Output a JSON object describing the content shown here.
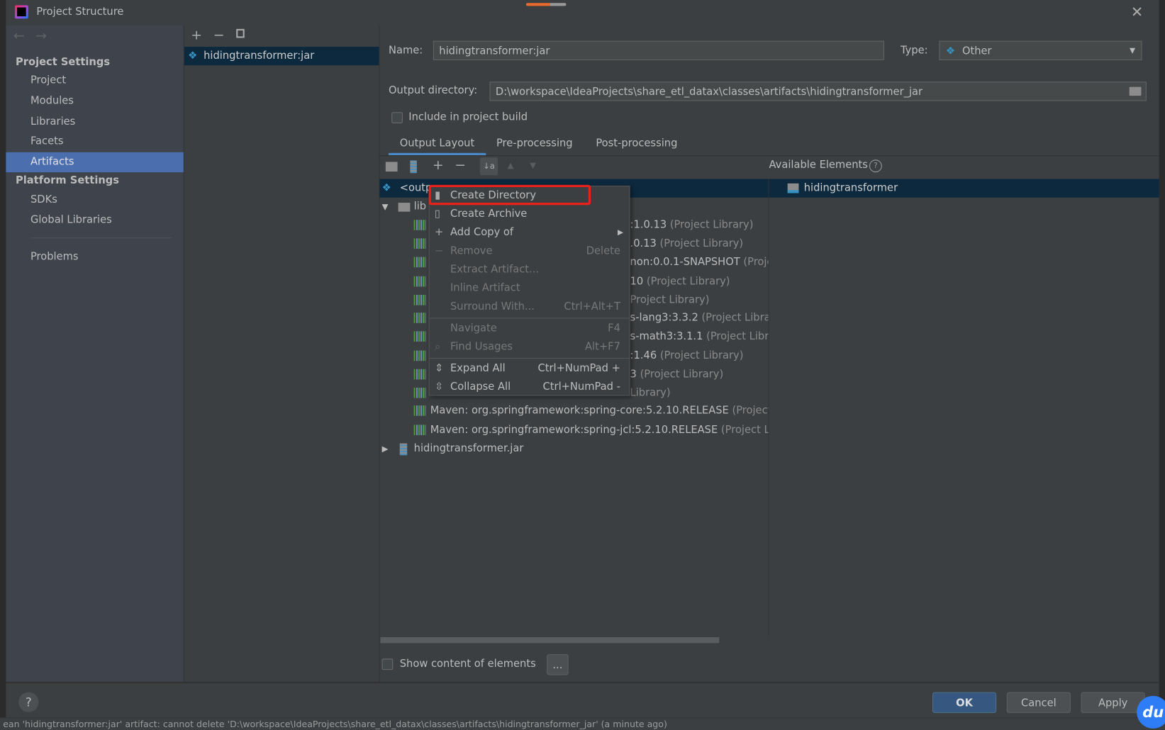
{
  "window": {
    "title": "Project Structure",
    "close_icon": "close-icon"
  },
  "sidebar": {
    "project_settings": "Project Settings",
    "items": [
      "Project",
      "Modules",
      "Libraries",
      "Facets",
      "Artifacts"
    ],
    "platform_settings": "Platform Settings",
    "platform_items": [
      "SDKs",
      "Global Libraries"
    ],
    "problems": "Problems",
    "selected": "Artifacts"
  },
  "artifacts": {
    "items": [
      "hidingtransformer:jar"
    ]
  },
  "details": {
    "name_label": "Name:",
    "name_value": "hidingtransformer:jar",
    "type_label": "Type:",
    "type_value": "Other",
    "output_label": "Output directory:",
    "output_value": "D:\\workspace\\IdeaProjects\\share_etl_datax\\classes\\artifacts\\hidingtransformer_jar",
    "include_build": "Include in project build",
    "include_build_checked": false,
    "tabs": [
      "Output Layout",
      "Pre-processing",
      "Post-processing"
    ],
    "active_tab": "Output Layout",
    "available_elements": "Available Elements",
    "available_items": [
      "hidingtransformer"
    ],
    "show_content": "Show content of elements",
    "show_content_checked": false,
    "ellipsis": "..."
  },
  "tree": {
    "root": "<outp",
    "libs": "lib",
    "libraries": [
      {
        "name": ":1.0.13",
        "suffix": "(Project Library)"
      },
      {
        "name": ".0.13",
        "suffix": "(Project Library)"
      },
      {
        "name": "non:0.0.1-SNAPSHOT",
        "suffix": "(Proje"
      },
      {
        "name": "10",
        "suffix": "(Project Library)"
      },
      {
        "name": "",
        "suffix": "Project Library)"
      },
      {
        "name": "s-lang3:3.3.2",
        "suffix": "(Project Libra"
      },
      {
        "name": "s-math3:3.1.1",
        "suffix": "(Project Libr"
      },
      {
        "name": ":1.46",
        "suffix": "(Project Library)"
      },
      {
        "name": "3",
        "suffix": "(Project Library)"
      },
      {
        "name": "",
        "suffix": "Library)"
      },
      {
        "name": "Maven: org.springframework:spring-core:5.2.10.RELEASE",
        "suffix": "(Project"
      },
      {
        "name": "Maven: org.springframework:spring-jcl:5.2.10.RELEASE",
        "suffix": "(Project Lil"
      }
    ],
    "jar": "hidingtransformer.jar"
  },
  "context_menu": {
    "items": [
      {
        "label": "Create Directory",
        "shortcut": "",
        "enabled": true,
        "highlighted": true
      },
      {
        "label": "Create Archive",
        "shortcut": "",
        "enabled": true
      },
      {
        "label": "Add Copy of",
        "shortcut": "",
        "enabled": true,
        "submenu": true
      },
      {
        "label": "Remove",
        "shortcut": "Delete",
        "enabled": false
      },
      {
        "label": "Extract Artifact...",
        "shortcut": "",
        "enabled": false
      },
      {
        "label": "Inline Artifact",
        "shortcut": "",
        "enabled": false
      },
      {
        "label": "Surround With...",
        "shortcut": "Ctrl+Alt+T",
        "enabled": false
      },
      {
        "label": "Navigate",
        "shortcut": "F4",
        "enabled": false
      },
      {
        "label": "Find Usages",
        "shortcut": "Alt+F7",
        "enabled": false
      },
      {
        "label": "Expand All",
        "shortcut": "Ctrl+NumPad +",
        "enabled": true
      },
      {
        "label": "Collapse All",
        "shortcut": "Ctrl+NumPad -",
        "enabled": true
      }
    ],
    "highlight_color": "#e8221b"
  },
  "footer": {
    "ok": "OK",
    "cancel": "Cancel",
    "apply": "Apply",
    "help": "?"
  },
  "status_bar": "ean 'hidingtransformer:jar' artifact: cannot delete 'D:\\workspace\\IdeaProjects\\share_etl_datax\\classes\\artifacts\\hidingtransformer_jar' (a minute ago)",
  "colors": {
    "selection": "#4b6eaf",
    "tree_selection": "#0d293e",
    "accent": "#3592c4",
    "ok_button": "#365880"
  }
}
